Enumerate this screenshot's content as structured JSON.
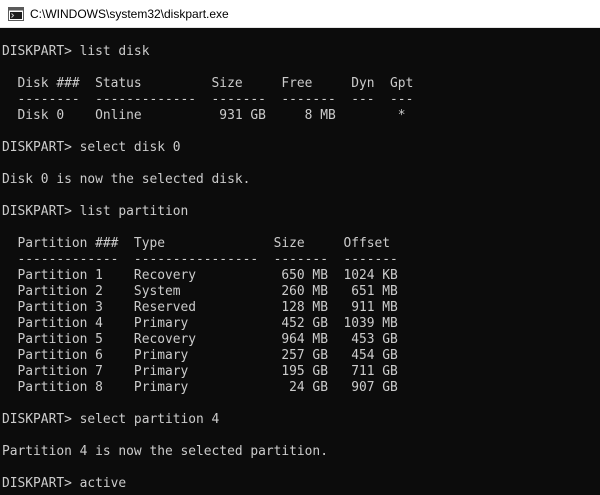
{
  "window": {
    "title": "C:\\WINDOWS\\system32\\diskpart.exe",
    "icon": "console-app-icon"
  },
  "console": {
    "lines": [
      "DISKPART> list disk",
      "",
      "  Disk ###  Status         Size     Free     Dyn  Gpt",
      "  --------  -------------  -------  -------  ---  ---",
      "  Disk 0    Online          931 GB     8 MB        *",
      "",
      "DISKPART> select disk 0",
      "",
      "Disk 0 is now the selected disk.",
      "",
      "DISKPART> list partition",
      "",
      "  Partition ###  Type              Size     Offset",
      "  -------------  ----------------  -------  -------",
      "  Partition 1    Recovery           650 MB  1024 KB",
      "  Partition 2    System             260 MB   651 MB",
      "  Partition 3    Reserved           128 MB   911 MB",
      "  Partition 4    Primary            452 GB  1039 MB",
      "  Partition 5    Recovery           964 MB   453 GB",
      "  Partition 6    Primary            257 GB   454 GB",
      "  Partition 7    Primary            195 GB   711 GB",
      "  Partition 8    Primary             24 GB   907 GB",
      "",
      "DISKPART> select partition 4",
      "",
      "Partition 4 is now the selected partition.",
      "",
      "DISKPART> active"
    ]
  }
}
